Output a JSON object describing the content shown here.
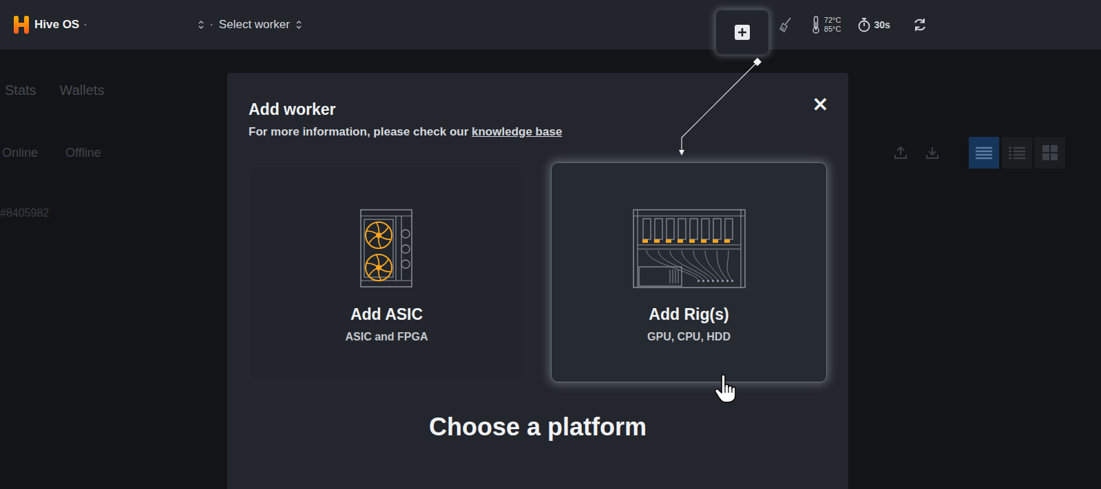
{
  "header": {
    "logo": "Hive OS",
    "logo_dot": "·",
    "farm_dot": "·",
    "worker_select": "Select worker",
    "add_highlighted": true,
    "temps": [
      "72°C",
      "85°C"
    ],
    "timer": "30s"
  },
  "page": {
    "tabs": [
      {
        "label": "Stats",
        "selected": false
      },
      {
        "label": "Wallets",
        "selected": false
      }
    ],
    "filters": [
      {
        "label": "Online",
        "selected": false
      },
      {
        "label": "Offline",
        "selected": false
      }
    ],
    "worker_id": "#8405982",
    "views": [
      {
        "kind": "list",
        "selected": true
      },
      {
        "kind": "compact",
        "selected": false
      },
      {
        "kind": "grid",
        "selected": false
      }
    ]
  },
  "modal": {
    "title": "Add worker",
    "subtitle": "For more information, please check our ",
    "link": "knowledge base",
    "close": "×",
    "options": [
      {
        "kind": "asic",
        "title": "Add ASIC",
        "subtitle": "ASIC and FPGA",
        "highlighted": false
      },
      {
        "kind": "rig",
        "title": "Add Rig(s)",
        "subtitle": "GPU, CPU, HDD",
        "highlighted": true
      }
    ],
    "section": "Choose a platform"
  }
}
